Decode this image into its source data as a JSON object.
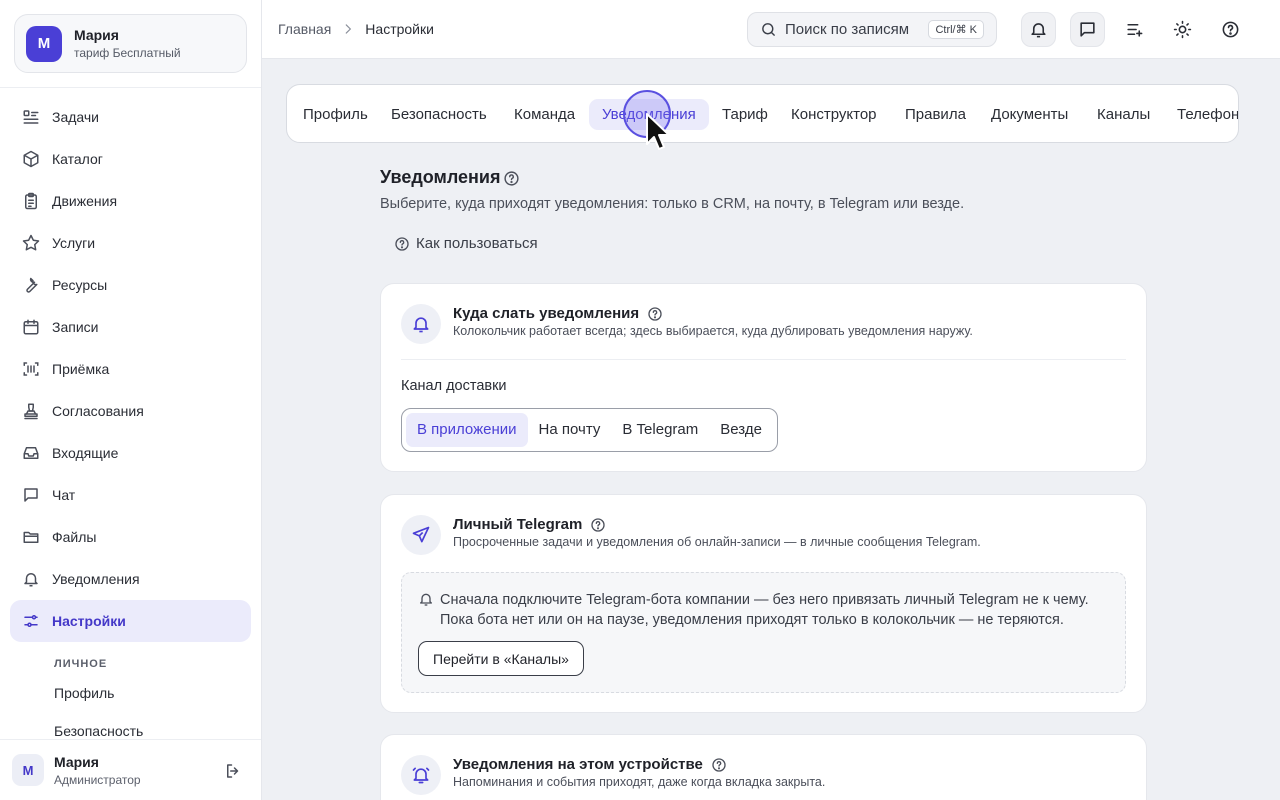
{
  "account": {
    "initial": "М",
    "name": "Мария",
    "plan": "тариф Бесплатный"
  },
  "sidebar": {
    "items": [
      {
        "label": "Задачи",
        "icon": "tasks-list-icon"
      },
      {
        "label": "Каталог",
        "icon": "box-icon"
      },
      {
        "label": "Движения",
        "icon": "clipboard-icon"
      },
      {
        "label": "Услуги",
        "icon": "star-icon"
      },
      {
        "label": "Ресурсы",
        "icon": "wrench-icon"
      },
      {
        "label": "Записи",
        "icon": "calendar-icon"
      },
      {
        "label": "Приёмка",
        "icon": "barcode-scan-icon"
      },
      {
        "label": "Согласования",
        "icon": "stamp-icon"
      },
      {
        "label": "Входящие",
        "icon": "inbox-icon"
      },
      {
        "label": "Чат",
        "icon": "chat-icon"
      },
      {
        "label": "Файлы",
        "icon": "folder-icon"
      },
      {
        "label": "Уведомления",
        "icon": "bell-icon"
      },
      {
        "label": "Настройки",
        "icon": "sliders-icon",
        "active": true
      }
    ],
    "subheading": "ЛИЧНОЕ",
    "subitems": [
      "Профиль",
      "Безопасность"
    ]
  },
  "user": {
    "initial": "М",
    "name": "Мария",
    "role": "Администратор"
  },
  "header": {
    "breadcrumb": [
      "Главная",
      "Настройки"
    ],
    "search_placeholder": "Поиск по записям",
    "search_shortcut": "Ctrl/⌘ K"
  },
  "tabs": [
    {
      "label": "Профиль"
    },
    {
      "label": "Безопасность"
    },
    {
      "label": "Команда"
    },
    {
      "label": "Уведомления",
      "active": true
    },
    {
      "label": "Тариф"
    },
    {
      "label": "Конструктор"
    },
    {
      "label": "Правила"
    },
    {
      "label": "Документы"
    },
    {
      "label": "Каналы"
    },
    {
      "label": "Телефония"
    }
  ],
  "page": {
    "title": "Уведомления",
    "subtitle": "Выберите, куда приходят уведомления: только в CRM, на почту, в Telegram или везде.",
    "howto": "Как пользоваться"
  },
  "delivery_card": {
    "title": "Куда слать уведомления",
    "description": "Колокольчик работает всегда; здесь выбирается, куда дублировать уведомления наружу.",
    "channel_label": "Канал доставки",
    "options": [
      "В приложении",
      "На почту",
      "В Telegram",
      "Везде"
    ],
    "selected_index": 0
  },
  "telegram_card": {
    "title": "Личный Telegram",
    "description": "Просроченные задачи и уведомления об онлайн-записи — в личные сообщения Telegram.",
    "notice_line1": "Сначала подключите Telegram-бота компании — без него привязать личный Telegram не к чему.",
    "notice_line2": "Пока бота нет или он на паузе, уведомления приходят только в колокольчик — не теряются.",
    "button_label": "Перейти в «Каналы»"
  },
  "device_card": {
    "title": "Уведомления на этом устройстве",
    "description": "Напоминания и события приходят, даже когда вкладка закрыта."
  },
  "colors": {
    "accent": "#4a3fd6",
    "accent_soft": "#ebebfb",
    "background": "#eef0f4"
  }
}
